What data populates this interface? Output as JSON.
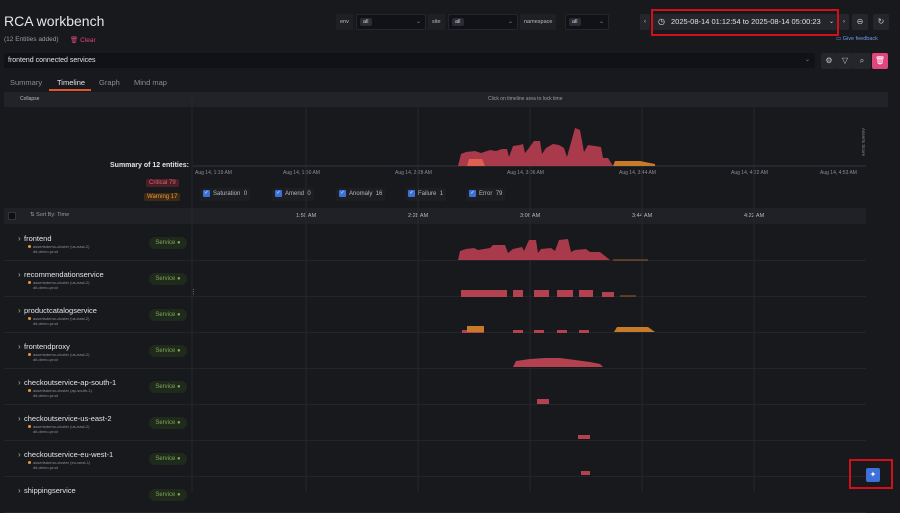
{
  "header": {
    "title": "RCA workbench",
    "entities_added": "(12 Entities added)",
    "clear_label": "Clear",
    "give_feedback": "Give feedback"
  },
  "filters": [
    {
      "label": "env",
      "value": "all"
    },
    {
      "label": "site",
      "value": "all"
    },
    {
      "label": "namespace",
      "value": "all"
    }
  ],
  "time_range": "2025-08-14 01:12:54 to 2025-08-14 05:00:23",
  "search": {
    "value": "frontend connected services"
  },
  "tabs": [
    "Summary",
    "Timeline",
    "Graph",
    "Mind map"
  ],
  "active_tab": "Timeline",
  "timeline_bar": {
    "collapse": "Collapse",
    "hint": "Click on timeline area to lock time"
  },
  "summary": {
    "title": "Summary of 12 entities:",
    "critical": "Critical 79",
    "warning": "Warning 17",
    "y_label": "Asserts Score",
    "x_ticks": [
      "Aug 14, 1:19 AM",
      "Aug 14, 1:50 AM",
      "Aug 14, 2:28 AM",
      "Aug 14, 3:06 AM",
      "Aug 14, 3:44 AM",
      "Aug 14, 4:22 AM",
      "Aug 14, 4:53 AM"
    ]
  },
  "legend": [
    {
      "label": "Saturation",
      "count": "0"
    },
    {
      "label": "Amend",
      "count": "0"
    },
    {
      "label": "Anomaly",
      "count": "16"
    },
    {
      "label": "Failure",
      "count": "1"
    },
    {
      "label": "Error",
      "count": "79"
    }
  ],
  "list_header": {
    "sort": "Sort By: Time",
    "ticks": [
      "1:50 AM",
      "2:28 AM",
      "3:06 AM",
      "3:44 AM",
      "4:22 AM"
    ]
  },
  "entities": [
    {
      "name": "frontend",
      "cluster": "assertsdemo-cluster (us-east-2)",
      "env": "dit-demo-prod",
      "type": "Service"
    },
    {
      "name": "recommendationservice",
      "cluster": "assertsdemo-cluster (us-east-2)",
      "env": "dit-demo-prod",
      "type": "Service"
    },
    {
      "name": "productcatalogservice",
      "cluster": "assertsdemo-cluster (us-east-2)",
      "env": "dit-demo-prod",
      "type": "Service"
    },
    {
      "name": "frontendproxy",
      "cluster": "assertsdemo-cluster (us-east-2)",
      "env": "dit-demo-prod",
      "type": "Service"
    },
    {
      "name": "checkoutservice-ap-south-1",
      "cluster": "assertsdemo-cluster (ap-south-1)",
      "env": "dit-demo-prod",
      "type": "Service"
    },
    {
      "name": "checkoutservice-us-east-2",
      "cluster": "assertsdemo-cluster (us-east-2)",
      "env": "dit-demo-prod",
      "type": "Service"
    },
    {
      "name": "checkoutservice-eu-west-1",
      "cluster": "assertsdemo-cluster (eu-west-1)",
      "env": "dit-demo-prod",
      "type": "Service"
    },
    {
      "name": "shippingservice",
      "cluster": "",
      "env": "",
      "type": "Service"
    }
  ],
  "colors": {
    "critical": "#b03a4a",
    "warning": "#d1862e",
    "accent": "#e0457b",
    "primary": "#3d71d9"
  }
}
